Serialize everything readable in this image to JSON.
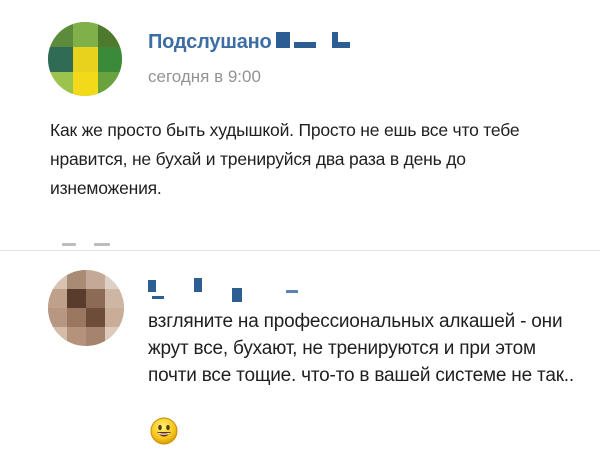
{
  "post": {
    "author": "Подслушано",
    "time": "сегодня в 9:00",
    "text": "Как же просто быть худышкой. Просто не ешь все что тебе нравится, не бухай и тренируйся два раза в день до изнеможения.",
    "avatar_icon": "pixelated-avatar-icon"
  },
  "comment": {
    "text": "взгляните на профессиональных алкашей - они жрут все, бухают, не тренируются и при этом почти все тощие. что-то в вашей системе не так..",
    "avatar_icon": "pixelated-avatar-icon",
    "emoji_icon": "smiley-emoji-icon"
  },
  "colors": {
    "author_link": "#3c6ea5",
    "redaction": "#2d5e93",
    "timestamp": "#939393",
    "text": "#1f1f1f",
    "divider": "#e1e3e6"
  }
}
